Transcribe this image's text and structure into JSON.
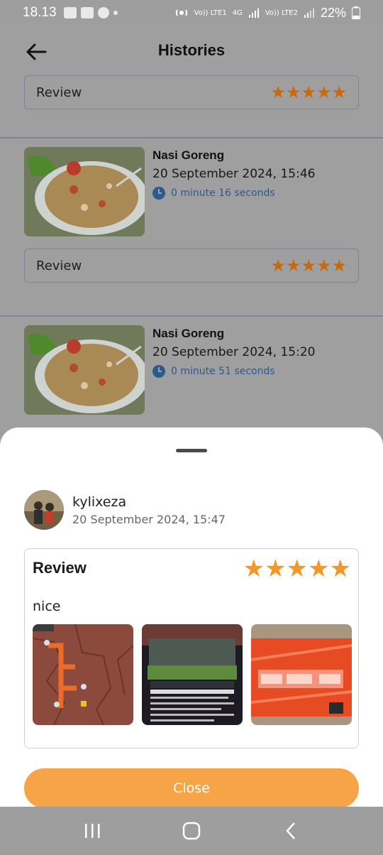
{
  "status_bar": {
    "time": "18.13",
    "battery": "22%",
    "network_1": "Vo)) LTE1",
    "network_2": "Vo)) LTE2",
    "network_type": "4G"
  },
  "header": {
    "title": "Histories",
    "back_icon": "arrow-left-icon"
  },
  "background_list": {
    "items": [
      {
        "review_label": "Review",
        "stars": "★★★★★"
      },
      {
        "name": "Nasi Goreng",
        "date": "20 September 2024, 15:46",
        "duration": "0 minute 16 seconds",
        "review_label": "Review",
        "stars": "★★★★★"
      },
      {
        "name": "Nasi Goreng",
        "date": "20 September 2024, 15:20",
        "duration": "0 minute 51 seconds"
      }
    ]
  },
  "sheet": {
    "reviewer": {
      "name": "kylixeza",
      "date": "20 September 2024, 15:47"
    },
    "review": {
      "title": "Review",
      "stars": "★★★★★",
      "rating": 5,
      "text": "nice"
    },
    "close_label": "Close"
  },
  "colors": {
    "accent": "#f7a347",
    "star": "#f39726",
    "link": "#2c5a8c",
    "scrim": "#9f9f9f"
  }
}
